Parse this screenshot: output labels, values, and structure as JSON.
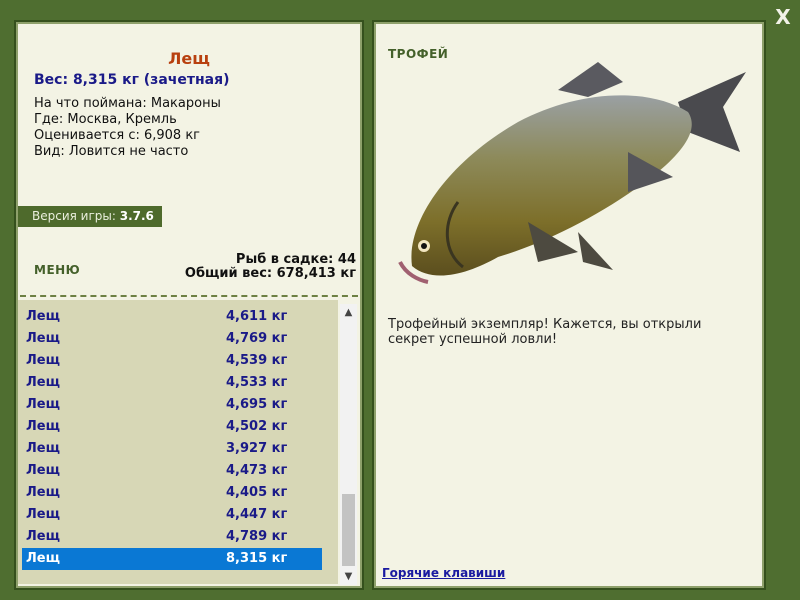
{
  "close_label": "X",
  "fish": {
    "name": "Лещ",
    "weight_line": "Вес: 8,315 кг (зачетная)",
    "bait_line": "На что поймана: Макароны",
    "place_line": "Где: Москва, Кремль",
    "rated_line": "Оценивается с: 6,908 кг",
    "kind_line": "Вид: Ловится не часто"
  },
  "version": {
    "label": "Версия игры:",
    "value": "3.7.6"
  },
  "menu_label": "МЕНЮ",
  "stats": {
    "count_line": "Рыб в садке: 44",
    "total_line": "Общий вес: 678,413 кг"
  },
  "catch_list": [
    {
      "name": "Лещ",
      "weight": "4,611 кг"
    },
    {
      "name": "Лещ",
      "weight": "4,769 кг"
    },
    {
      "name": "Лещ",
      "weight": "4,539 кг"
    },
    {
      "name": "Лещ",
      "weight": "4,533 кг"
    },
    {
      "name": "Лещ",
      "weight": "4,695 кг"
    },
    {
      "name": "Лещ",
      "weight": "4,502 кг"
    },
    {
      "name": "Лещ",
      "weight": "3,927 кг"
    },
    {
      "name": "Лещ",
      "weight": "4,473 кг"
    },
    {
      "name": "Лещ",
      "weight": "4,405 кг"
    },
    {
      "name": "Лещ",
      "weight": "4,447 кг"
    },
    {
      "name": "Лещ",
      "weight": "4,789 кг"
    },
    {
      "name": "Лещ",
      "weight": "8,315 кг"
    }
  ],
  "selected_index": 11,
  "trophy": {
    "label": "ТРОФЕЙ",
    "text": "Трофейный экземпляр! Кажется, вы открыли секрет успешной ловли!"
  },
  "hotkeys_label": "Горячие клавиши",
  "colors": {
    "frame": "#4f6e30",
    "panel": "#f3f3e4",
    "list_bg": "#d7d7b6",
    "selected": "#0a78d4",
    "accent_text": "#1a1a88",
    "title": "#b8400f"
  }
}
